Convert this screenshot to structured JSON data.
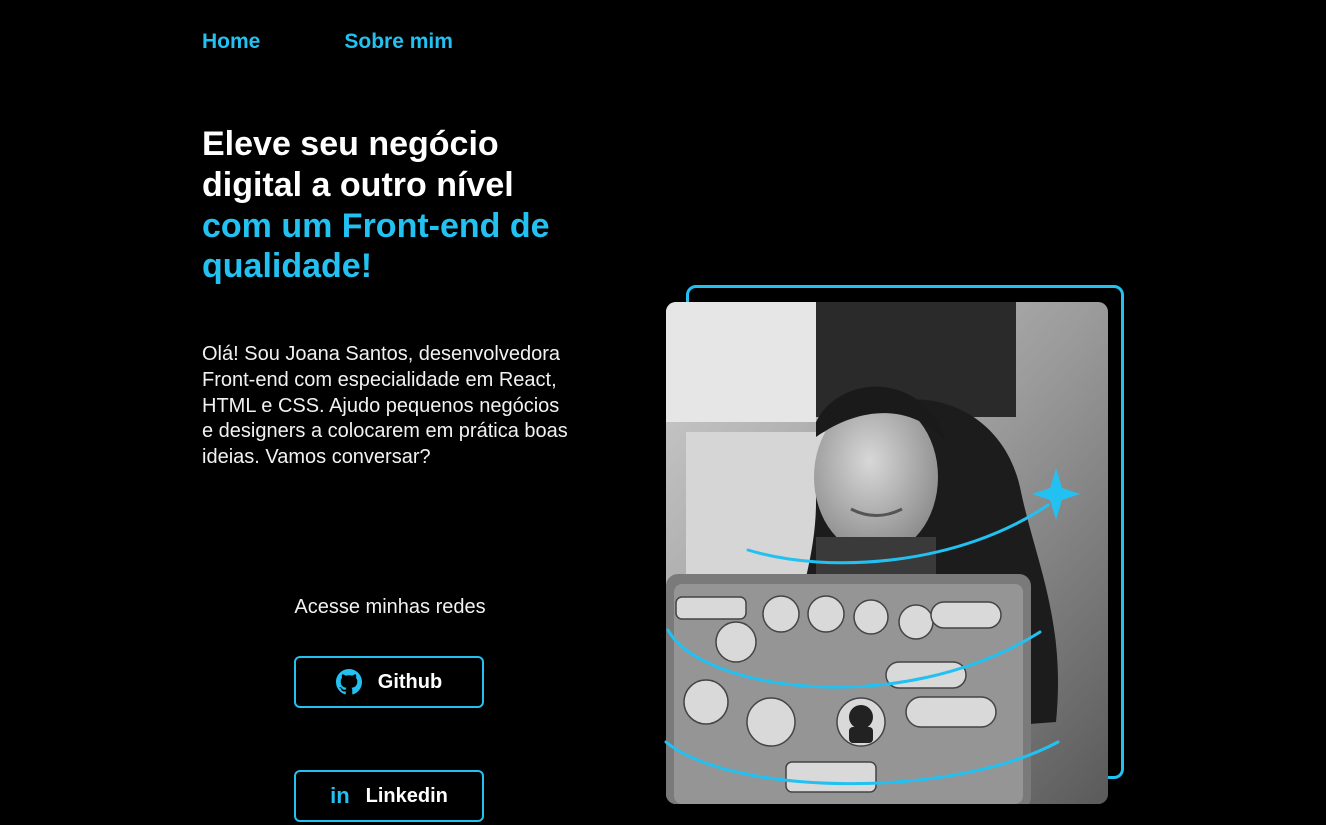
{
  "nav": {
    "items": [
      {
        "label": "Home"
      },
      {
        "label": "Sobre mim"
      }
    ]
  },
  "hero": {
    "headline_line1": "Eleve seu negócio digital a outro nível",
    "headline_accent": "com um Front-end de qualidade!",
    "intro": "Olá! Sou Joana Santos, desenvolvedora Front-end com especialidade em React, HTML e CSS. Ajudo pequenos negócios e designers a colocarem em prática boas ideias. Vamos conversar?",
    "photo_alt": "Joana Santos sorrindo em frente a um notebook com adesivos"
  },
  "social": {
    "title": "Acesse minhas redes",
    "buttons": [
      {
        "label": "Github",
        "icon": "github-icon"
      },
      {
        "label": "Linkedin",
        "icon": "linkedin-icon",
        "icon_text": "in"
      }
    ]
  },
  "colors": {
    "accent": "#22c1f1",
    "background": "#000000",
    "text": "#ffffff"
  }
}
